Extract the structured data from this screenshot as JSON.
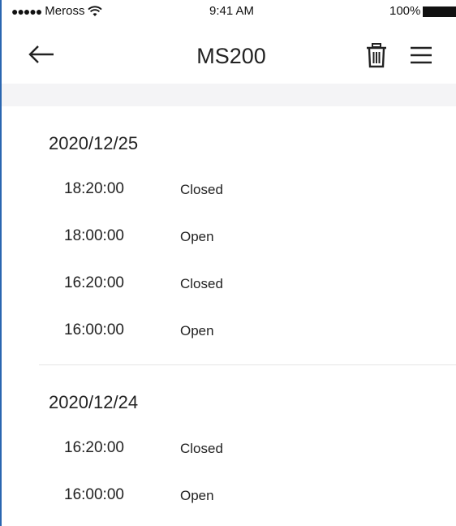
{
  "status_bar": {
    "signal_dots": "●●●●●",
    "carrier": "Meross",
    "time": "9:41 AM",
    "battery": "100%"
  },
  "header": {
    "title": "MS200",
    "back_icon": "back-arrow-icon",
    "delete_icon": "trash-icon",
    "menu_icon": "menu-icon"
  },
  "history": [
    {
      "date": "2020/12/25",
      "entries": [
        {
          "time": "18:20:00",
          "state": "Closed"
        },
        {
          "time": "18:00:00",
          "state": "Open"
        },
        {
          "time": "16:20:00",
          "state": "Closed"
        },
        {
          "time": "16:00:00",
          "state": "Open"
        }
      ]
    },
    {
      "date": "2020/12/24",
      "entries": [
        {
          "time": "16:20:00",
          "state": "Closed"
        },
        {
          "time": "16:00:00",
          "state": "Open"
        }
      ]
    }
  ]
}
